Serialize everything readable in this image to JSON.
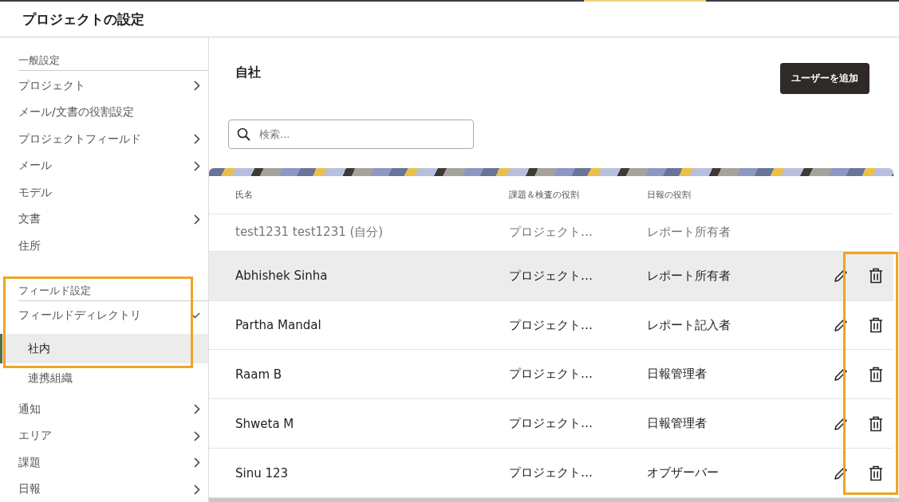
{
  "header": {
    "title": "プロジェクトの設定"
  },
  "sidebar": {
    "sections": [
      {
        "heading": "一般設定",
        "items": [
          {
            "label": "プロジェクト",
            "kind": "branch",
            "expanded": false
          },
          {
            "label": "メール/文書の役割設定",
            "kind": "leaf"
          },
          {
            "label": "プロジェクトフィールド",
            "kind": "branch",
            "expanded": false
          },
          {
            "label": "メール",
            "kind": "branch",
            "expanded": false
          },
          {
            "label": "モデル",
            "kind": "leaf"
          },
          {
            "label": "文書",
            "kind": "branch",
            "expanded": false
          },
          {
            "label": "住所",
            "kind": "leaf"
          }
        ]
      },
      {
        "heading": "フィールド設定",
        "items": [
          {
            "label": "フィールドディレクトリ",
            "kind": "branch",
            "expanded": true,
            "children": [
              {
                "label": "社内",
                "selected": true
              },
              {
                "label": "連携組織",
                "selected": false
              }
            ]
          },
          {
            "label": "通知",
            "kind": "branch",
            "expanded": false
          },
          {
            "label": "エリア",
            "kind": "branch",
            "expanded": false
          },
          {
            "label": "課題",
            "kind": "branch",
            "expanded": false
          },
          {
            "label": "日報",
            "kind": "branch",
            "expanded": false
          }
        ]
      }
    ]
  },
  "main": {
    "title": "自社",
    "add_button": "ユーザーを追加",
    "search": {
      "placeholder": "検索..."
    },
    "table": {
      "columns": [
        "氏名",
        "課題＆検査の役割",
        "日報の役割"
      ],
      "rows": [
        {
          "name": "test1231 test1231 (自分)",
          "issue_role": "プロジェクト…",
          "report_role": "レポート所有者",
          "disabled": true,
          "highlighted": false
        },
        {
          "name": "Abhishek Sinha",
          "issue_role": "プロジェクト…",
          "report_role": "レポート所有者",
          "disabled": false,
          "highlighted": true
        },
        {
          "name": "Partha Mandal",
          "issue_role": "プロジェクト…",
          "report_role": "レポート記入者",
          "disabled": false,
          "highlighted": false
        },
        {
          "name": "Raam B",
          "issue_role": "プロジェクト…",
          "report_role": "日報管理者",
          "disabled": false,
          "highlighted": false
        },
        {
          "name": "Shweta M",
          "issue_role": "プロジェクト…",
          "report_role": "日報管理者",
          "disabled": false,
          "highlighted": false
        },
        {
          "name": "Sinu 123",
          "issue_role": "プロジェクト…",
          "report_role": "オブザーバー",
          "disabled": false,
          "highlighted": false
        }
      ]
    }
  }
}
